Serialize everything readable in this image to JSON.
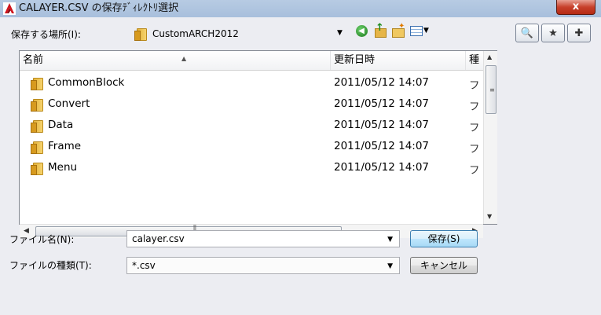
{
  "window": {
    "title": "CALAYER.CSV の保存ﾃﾞｨﾚｸﾄﾘ選択",
    "close_label": "x"
  },
  "location": {
    "label": "保存する場所(I):",
    "value": "CustomARCH2012"
  },
  "toolbar": {
    "back_icon": "back-icon",
    "up_icon": "up-folder-icon",
    "new_folder_icon": "new-folder-icon",
    "views_icon": "views-menu-icon"
  },
  "right_tools": [
    {
      "name": "search-web-icon",
      "glyph": "🔍"
    },
    {
      "name": "favorites-icon",
      "glyph": "★"
    },
    {
      "name": "add-favorite-icon",
      "glyph": "✚"
    }
  ],
  "list": {
    "columns": {
      "name": "名前",
      "modified": "更新日時",
      "type": "種"
    },
    "rows": [
      {
        "name": "CommonBlock",
        "modified": "2011/05/12 14:07",
        "type": "フ"
      },
      {
        "name": "Convert",
        "modified": "2011/05/12 14:07",
        "type": "フ"
      },
      {
        "name": "Data",
        "modified": "2011/05/12 14:07",
        "type": "フ"
      },
      {
        "name": "Frame",
        "modified": "2011/05/12 14:07",
        "type": "フ"
      },
      {
        "name": "Menu",
        "modified": "2011/05/12 14:07",
        "type": "フ"
      }
    ]
  },
  "filename": {
    "label": "ファイル名(N):",
    "value": "calayer.csv"
  },
  "filetype": {
    "label": "ファイルの種類(T):",
    "value": "*.csv"
  },
  "buttons": {
    "save": "保存(S)",
    "cancel": "キャンセル"
  }
}
